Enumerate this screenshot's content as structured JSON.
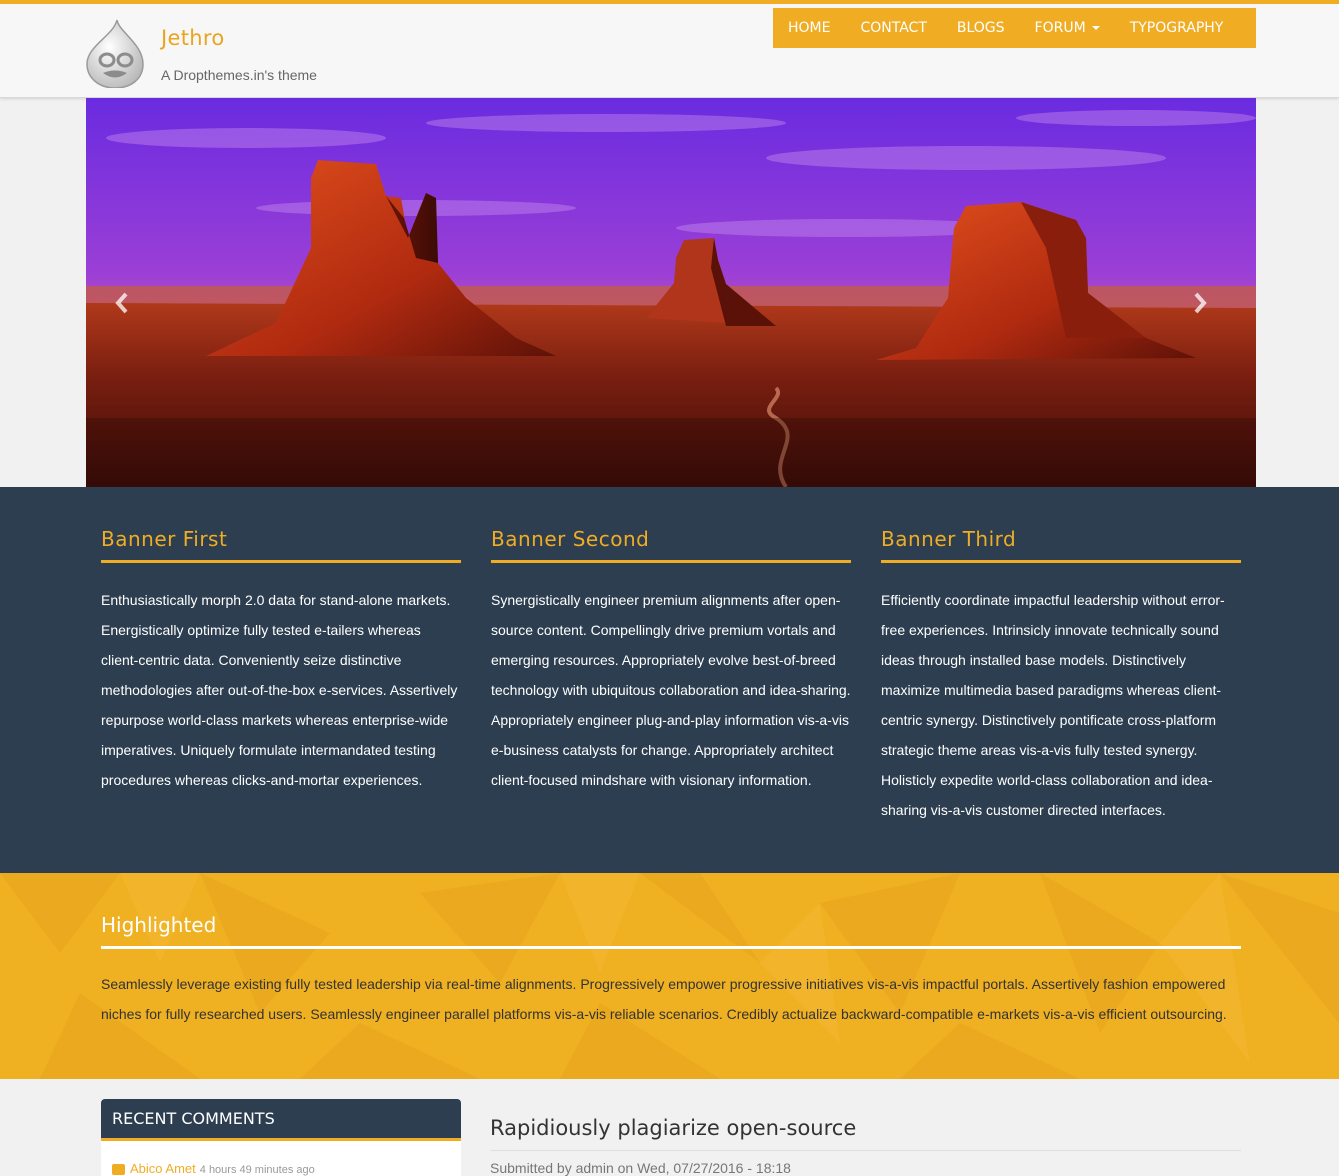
{
  "header": {
    "logo_icon": "drupal-drop-icon",
    "site_name": "Jethro",
    "site_slogan": "A Dropthemes.in's theme"
  },
  "nav": {
    "items": [
      {
        "label": "HOME"
      },
      {
        "label": "CONTACT"
      },
      {
        "label": "BLOGS"
      },
      {
        "label": "FORUM"
      },
      {
        "label": "TYPOGRAPHY"
      }
    ]
  },
  "slider": {
    "prev_icon": "chevron-left-icon",
    "next_icon": "chevron-right-icon"
  },
  "banner": {
    "columns": [
      {
        "title": "Banner First",
        "text": "Enthusiastically morph 2.0 data for stand-alone markets. Energistically optimize fully tested e-tailers whereas client-centric data. Conveniently seize distinctive methodologies after out-of-the-box e-services. Assertively repurpose world-class markets whereas enterprise-wide imperatives. Uniquely formulate intermandated testing procedures whereas clicks-and-mortar experiences."
      },
      {
        "title": "Banner Second",
        "text": "Synergistically engineer premium alignments after open-source content. Compellingly drive premium vortals and emerging resources. Appropriately evolve best-of-breed technology with ubiquitous collaboration and idea-sharing. Appropriately engineer plug-and-play information vis-a-vis e-business catalysts for change. Appropriately architect client-focused mindshare with visionary information."
      },
      {
        "title": "Banner Third",
        "text": "Efficiently coordinate impactful leadership without error-free experiences. Intrinsicly innovate technically sound ideas through installed base models. Distinctively maximize multimedia based paradigms whereas client-centric synergy. Distinctively pontificate cross-platform strategic theme areas vis-a-vis fully tested synergy. Holisticly expedite world-class collaboration and idea-sharing vis-a-vis customer directed interfaces."
      }
    ]
  },
  "highlighted": {
    "title": "Highlighted",
    "text": "Seamlessly leverage existing fully tested leadership via real-time alignments. Progressively empower progressive initiatives vis-a-vis impactful portals. Assertively fashion empowered niches for fully researched users. Seamlessly engineer parallel platforms vis-a-vis reliable scenarios. Credibly actualize backward-compatible e-markets vis-a-vis efficient outsourcing."
  },
  "recent_comments": {
    "title": "RECENT COMMENTS",
    "items": [
      {
        "author": "Abico Amet",
        "time": "4 hours 49 minutes ago"
      }
    ]
  },
  "article": {
    "title": "Rapidiously plagiarize open-source",
    "meta": "Submitted by admin on Wed, 07/27/2016 - 18:18"
  },
  "colors": {
    "accent": "#f0ad24",
    "banner_bg": "#2d3e50",
    "highlight_bg": "#efb022"
  }
}
